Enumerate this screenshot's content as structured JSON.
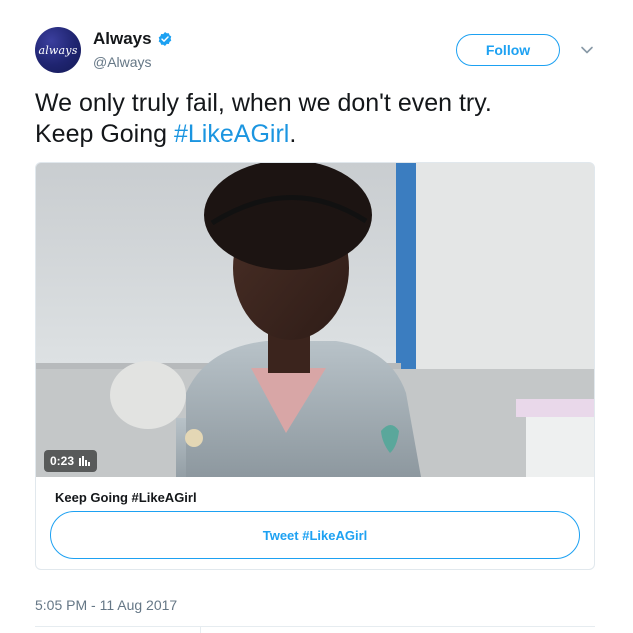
{
  "account": {
    "avatar_text": "always",
    "display_name": "Always",
    "handle": "@Always"
  },
  "follow_label": "Follow",
  "tweet": {
    "text_line1": "We only truly fail, when we don't even try.",
    "text_line2_prefix": "Keep Going ",
    "hashtag": "#LikeAGirl",
    "text_line2_suffix": "."
  },
  "card": {
    "duration": "0:23",
    "title": "Keep Going #LikeAGirl",
    "button_label": "Tweet #LikeAGirl"
  },
  "timestamp": "5:05 PM - 11 Aug 2017",
  "colors": {
    "accent": "#1da1f2",
    "hashtag": "#1b95e0",
    "secondary_text": "#657786",
    "brand_navy": "#1f2470"
  },
  "icons": {
    "verified": "verified-badge-icon",
    "caret": "chevron-down-icon",
    "volume": "volume-bars-icon"
  }
}
